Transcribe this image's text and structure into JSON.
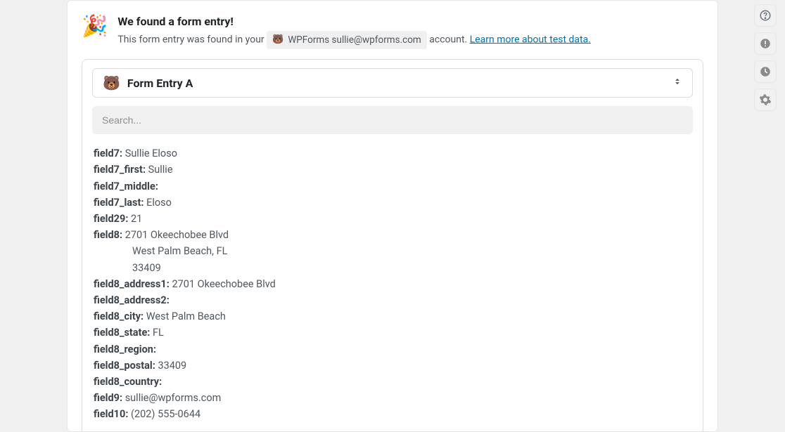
{
  "notice": {
    "emoji": "🎉",
    "title": "We found a form entry!",
    "subtitle_prefix": "This form entry was found in your ",
    "account_brand_icon": "🐻",
    "account_text": "WPForms sullie@wpforms.com",
    "subtitle_mid": " account. ",
    "learn_more": "Learn more about test data."
  },
  "entry": {
    "icon": "🐻",
    "title": "Form Entry A"
  },
  "search": {
    "placeholder": "Search..."
  },
  "fields": {
    "field7": {
      "label": "field7:",
      "value": " Sullie Eloso"
    },
    "field7_first": {
      "label": "field7_first:",
      "value": " Sullie"
    },
    "field7_middle": {
      "label": "field7_middle:",
      "value": ""
    },
    "field7_last": {
      "label": "field7_last:",
      "value": " Eloso"
    },
    "field29": {
      "label": "field29:",
      "value": " 21"
    },
    "field8": {
      "label": "field8:",
      "value": " 2701 Okeechobee Blvd",
      "line2": "West Palm Beach, FL",
      "line3": "33409"
    },
    "field8_address1": {
      "label": "field8_address1:",
      "value": " 2701 Okeechobee Blvd"
    },
    "field8_address2": {
      "label": "field8_address2:",
      "value": ""
    },
    "field8_city": {
      "label": "field8_city:",
      "value": " West Palm Beach"
    },
    "field8_state": {
      "label": "field8_state:",
      "value": " FL"
    },
    "field8_region": {
      "label": "field8_region:",
      "value": ""
    },
    "field8_postal": {
      "label": "field8_postal:",
      "value": " 33409"
    },
    "field8_country": {
      "label": "field8_country:",
      "value": ""
    },
    "field9": {
      "label": "field9:",
      "value": " sullie@wpforms.com"
    },
    "field10": {
      "label": "field10:",
      "value": " (202) 555-0644"
    }
  }
}
